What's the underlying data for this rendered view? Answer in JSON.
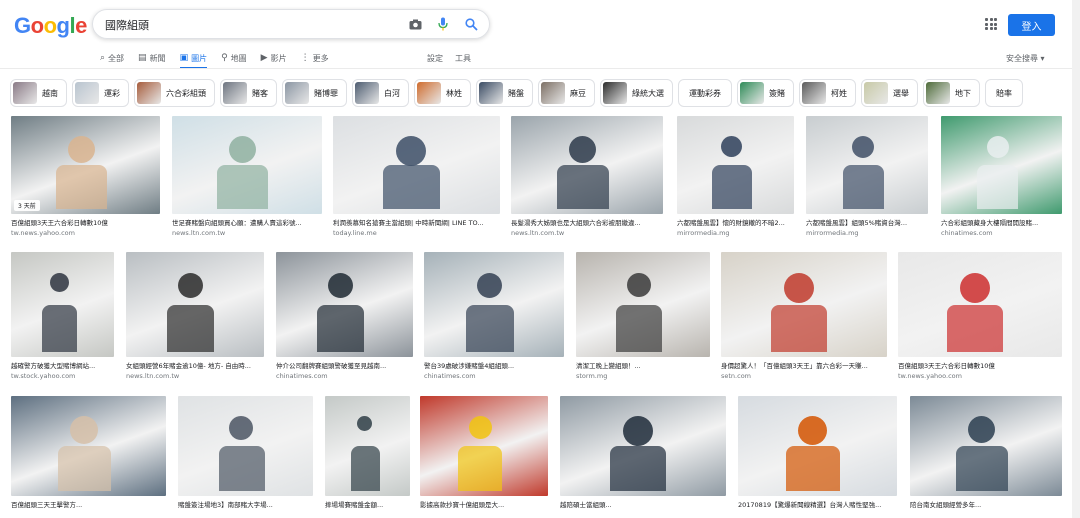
{
  "logo": {
    "letters": [
      "G",
      "o",
      "o",
      "g",
      "l",
      "e"
    ],
    "colors": [
      "#4285F4",
      "#EA4335",
      "#FBBC05",
      "#4285F4",
      "#34A853",
      "#EA4335"
    ]
  },
  "search": {
    "query": "國際組頭"
  },
  "header": {
    "login_label": "登入"
  },
  "nav": {
    "tabs": [
      {
        "label": "全部",
        "icon": "search-icon"
      },
      {
        "label": "新聞",
        "icon": "news-icon"
      },
      {
        "label": "圖片",
        "icon": "image-icon",
        "active": true
      },
      {
        "label": "地圖",
        "icon": "map-pin-icon"
      },
      {
        "label": "影片",
        "icon": "video-icon"
      },
      {
        "label": "更多",
        "icon": "more-dots-icon"
      }
    ],
    "settings_label": "設定",
    "tools_label": "工具",
    "safe_search_label": "安全搜尋"
  },
  "chips": [
    {
      "label": "越南",
      "color": "#8a7a86"
    },
    {
      "label": "運彩",
      "color": "#b9c4cf"
    },
    {
      "label": "六合彩組頭",
      "color": "#a65c3c"
    },
    {
      "label": "賭客",
      "color": "#6d7480"
    },
    {
      "label": "賭博罪",
      "color": "#8b96a3"
    },
    {
      "label": "白河",
      "color": "#4d5c70"
    },
    {
      "label": "林姓",
      "color": "#cf6c2e"
    },
    {
      "label": "賭盤",
      "color": "#3a4b63"
    },
    {
      "label": "麻豆",
      "color": "#7c6f64"
    },
    {
      "label": "綠統大選",
      "color": "#2c2c2c"
    },
    {
      "label": "運動彩券",
      "color": null
    },
    {
      "label": "簽賭",
      "color": "#2e8b57"
    },
    {
      "label": "柯姓",
      "color": "#5a5a5a"
    },
    {
      "label": "選舉",
      "color": "#c7c9a6"
    },
    {
      "label": "地下",
      "color": "#4e6b3a"
    },
    {
      "label": "賠率",
      "color": null
    }
  ],
  "results": [
    {
      "title": "百億組頭3天王六合彩日轉數10億",
      "source": "tw.news.yahoo.com",
      "badge": "3 天前",
      "bg": "#6f7d84",
      "accent": "#d9b48f"
    },
    {
      "title": "世足賽賭盤向組頭買心願：遭購人賣這彩號...",
      "source": "news.ltn.com.tw",
      "badge": "",
      "bg": "#cfdfe6",
      "accent": "#8fb0a0"
    },
    {
      "title": "利潤羨慕知名搶賽主當組頭| 中時新聞網| LINE TO...",
      "source": "today.line.me",
      "badge": "",
      "bg": "#dcdfe2",
      "accent": "#3c4e66"
    },
    {
      "title": "長髮湯秀大姊頭也是大組頭六合彩被朋繳違...",
      "source": "news.ltn.com.tw",
      "badge": "",
      "bg": "#9aa4ab",
      "accent": "#2d3a4a"
    },
    {
      "title": "六都賭盤風雲】懷的財鏡轍的不暗2...",
      "source": "mirrormedia.mg",
      "badge": "",
      "bg": "#d8dadb",
      "accent": "#2e3f5a"
    },
    {
      "title": "六都賭盤風雲】組頭5%賭資台灣...",
      "source": "mirrormedia.mg",
      "badge": "",
      "bg": "#c8cdd0",
      "accent": "#3f4f66"
    },
    {
      "title": "六合彩組頭藏身大樓隔間開設賭...",
      "source": "chinatimes.com",
      "badge": "",
      "bg": "#3f9a6e",
      "accent": "#e9eef0"
    },
    {
      "title": "越確警方破獲大型賭博網站...",
      "source": "tw.stock.yahoo.com",
      "badge": "",
      "bg": "#c5c7c3",
      "accent": "#2e3440"
    },
    {
      "title": "女組頭經營6年賭金逾10億- 地方- 自由時...",
      "source": "news.ltn.com.tw",
      "badge": "",
      "bg": "#b9bec2",
      "accent": "#2a2a2a"
    },
    {
      "title": "仲介公司翻牌賽組頭警破獲至見越南...",
      "source": "chinatimes.com",
      "badge": "",
      "bg": "#8c939a",
      "accent": "#1f2933"
    },
    {
      "title": "警台39處破涉嫌賭盤4組組頭...",
      "source": "chinatimes.com",
      "badge": "",
      "bg": "#a5b1b8",
      "accent": "#334052"
    },
    {
      "title": "清潔工晚上變組頭！...",
      "source": "storm.mg",
      "badge": "",
      "bg": "#b8b4ae",
      "accent": "#3a3a3a"
    },
    {
      "title": "身價超驚人！「百億組頭3天王」靠六合彩一天賺...",
      "source": "setn.com",
      "badge": "",
      "bg": "#d7d2c8",
      "accent": "#c0392b"
    },
    {
      "title": "百億組頭3天王六合彩日轉數10億",
      "source": "tw.news.yahoo.com",
      "badge": "",
      "bg": "#e8e8e8",
      "accent": "#cc2e2e"
    },
    {
      "title": "百億組頭三天王擊警方...",
      "source": "",
      "badge": "",
      "bg": "#5d6f80",
      "accent": "#d6c0a8"
    },
    {
      "title": "賭盤簽注場地3】南部賭大字場...",
      "source": "",
      "badge": "",
      "bg": "#dfe2e4",
      "accent": "#4b5563"
    },
    {
      "title": "摔場場賽賭盤金額...",
      "source": "",
      "badge": "",
      "bg": "#c4c9c7",
      "accent": "#2f3e46"
    },
    {
      "title": "影據高款抄寶十億組頭是大...",
      "source": "",
      "badge": "",
      "bg": "#c0392b",
      "accent": "#f1c40f"
    },
    {
      "title": "越陪碩士當組頭...",
      "source": "",
      "badge": "",
      "bg": "#8f9aa3",
      "accent": "#1e2b3a"
    },
    {
      "title": "20170819【驚爆新聞線精選】台灣人賭性堅強...",
      "source": "",
      "badge": "",
      "bg": "#d6dbe0",
      "accent": "#d35400"
    },
    {
      "title": "陪台南女組頭經營多年...",
      "source": "",
      "badge": "",
      "bg": "#7c8a96",
      "accent": "#2c3e50"
    }
  ]
}
